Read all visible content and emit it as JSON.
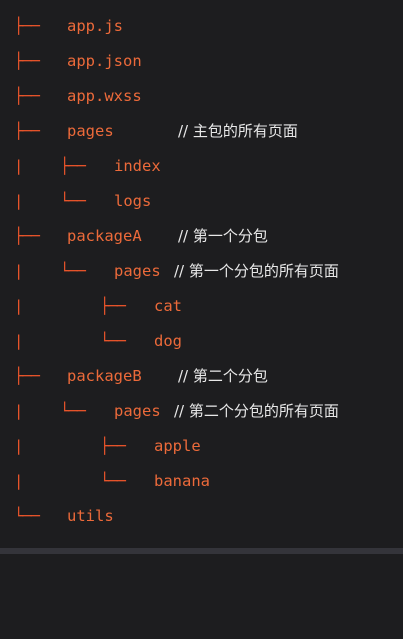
{
  "tree": [
    {
      "branch": "├──",
      "name": "app.js",
      "comment": ""
    },
    {
      "branch": "├──",
      "name": "app.json",
      "comment": ""
    },
    {
      "branch": "├──",
      "name": "app.wxss",
      "comment": ""
    },
    {
      "branch": "├──",
      "name": "pages",
      "comment": "// 主包的所有页面"
    },
    {
      "guide": "|",
      "branch": "├──",
      "name": "index",
      "comment": ""
    },
    {
      "guide": "|",
      "branch": "└──",
      "name": "logs",
      "comment": ""
    },
    {
      "branch": "├──",
      "name": "packageA",
      "comment": "// 第一个分包"
    },
    {
      "guide": "|",
      "branch": "└──",
      "name": "pages",
      "comment": "// 第一个分包的所有页面"
    },
    {
      "guide": "|",
      "branch": "├──",
      "name": "cat",
      "comment": ""
    },
    {
      "guide": "|",
      "branch": "└──",
      "name": "dog",
      "comment": ""
    },
    {
      "branch": "├──",
      "name": "packageB",
      "comment": "// 第二个分包"
    },
    {
      "guide": "|",
      "branch": "└──",
      "name": "pages",
      "comment": "// 第二个分包的所有页面"
    },
    {
      "guide": "|",
      "branch": "├──",
      "name": "apple",
      "comment": ""
    },
    {
      "guide": "|",
      "branch": "└──",
      "name": "banana",
      "comment": ""
    },
    {
      "branch": "└──",
      "name": "utils",
      "comment": ""
    }
  ],
  "colors": {
    "background": "#1d1d1f",
    "branch": "#e8542a",
    "name": "#ec6a3a",
    "comment": "#e8e8e8"
  }
}
